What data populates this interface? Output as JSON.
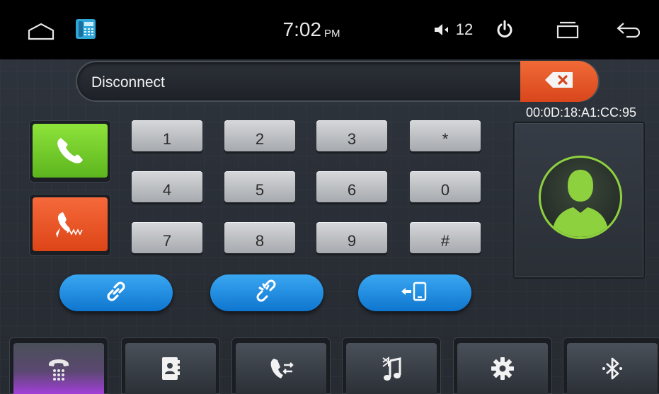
{
  "status_bar": {
    "time": "7:02",
    "ampm": "PM",
    "volume": "12",
    "icons": [
      "home-icon",
      "phone-app-icon",
      "volume-icon",
      "power-icon",
      "recent-apps-icon",
      "back-icon"
    ]
  },
  "dialer": {
    "display_text": "Disconnect",
    "device_address": "00:0D:18:A1:CC:95",
    "keys": [
      "1",
      "2",
      "3",
      "*",
      "4",
      "5",
      "6",
      "0",
      "7",
      "8",
      "9",
      "#"
    ]
  },
  "actions": {
    "answer": "answer-call-icon",
    "hangup": "hangup-call-icon",
    "connect": "link-icon",
    "disconnect": "unlink-icon",
    "transfer": "transfer-audio-icon"
  },
  "tabs": [
    {
      "name": "dialpad",
      "icon": "dialpad-phone-icon",
      "active": true
    },
    {
      "name": "contacts",
      "icon": "contacts-book-icon",
      "active": false
    },
    {
      "name": "call-log",
      "icon": "call-log-icon",
      "active": false
    },
    {
      "name": "music",
      "icon": "bluetooth-music-icon",
      "active": false
    },
    {
      "name": "settings",
      "icon": "gear-icon",
      "active": false
    },
    {
      "name": "bluetooth",
      "icon": "bluetooth-icon",
      "active": false
    }
  ],
  "colors": {
    "answer": "#6cc425",
    "hangup": "#e8511f",
    "accent_blue": "#1f8de0",
    "avatar_green": "#8ed13f",
    "active_tab": "#a23fd8"
  }
}
